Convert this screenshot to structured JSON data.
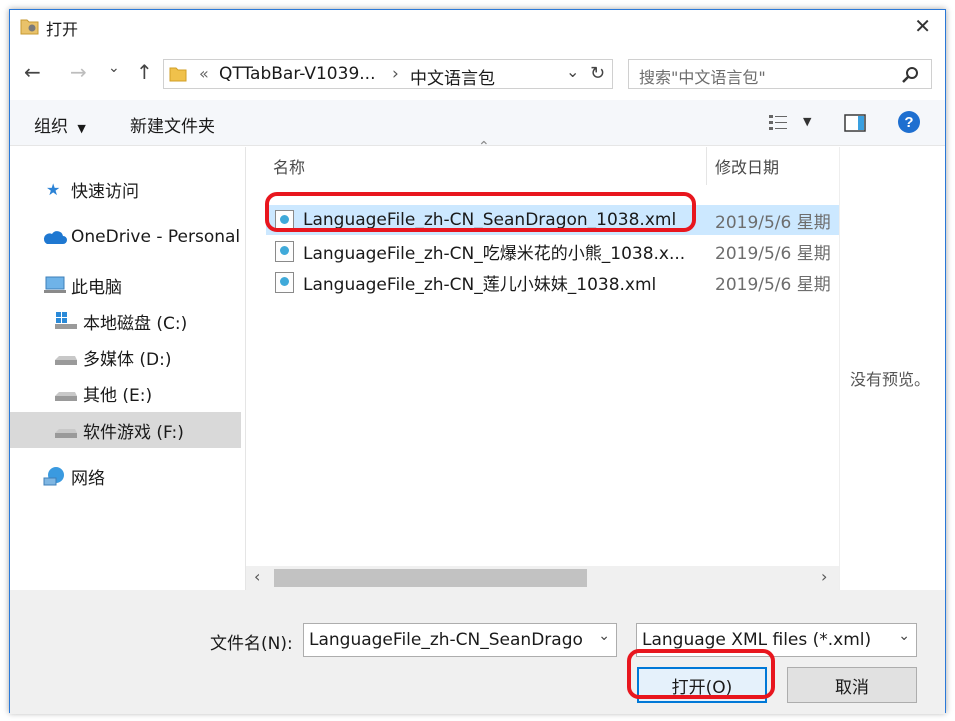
{
  "window": {
    "title": "打开"
  },
  "nav": {
    "back": "←",
    "forward": "→",
    "recent": "⌄",
    "up": "↑",
    "refresh": "↻"
  },
  "address": {
    "overflow": "«",
    "segments": [
      "QTTabBar-V1039...",
      "中文语言包"
    ],
    "separator": "›"
  },
  "search": {
    "placeholder": "搜索\"中文语言包\""
  },
  "toolbar": {
    "organize": "组织",
    "new_folder": "新建文件夹"
  },
  "sidebar": {
    "items": [
      {
        "label": "快速访问"
      },
      {
        "label": "OneDrive - Personal"
      },
      {
        "label": "此电脑"
      },
      {
        "label": "本地磁盘 (C:)"
      },
      {
        "label": "多媒体 (D:)"
      },
      {
        "label": "其他 (E:)"
      },
      {
        "label": "软件游戏 (F:)"
      },
      {
        "label": "网络"
      }
    ]
  },
  "columns": {
    "name": "名称",
    "modified": "修改日期"
  },
  "files": [
    {
      "name": "LanguageFile_zh-CN_SeanDragon_1038.xml",
      "date": "2019/5/6 星期"
    },
    {
      "name": "LanguageFile_zh-CN_吃爆米花的小熊_1038.x...",
      "date": "2019/5/6 星期"
    },
    {
      "name": "LanguageFile_zh-CN_莲儿小妹妹_1038.xml",
      "date": "2019/5/6 星期"
    }
  ],
  "preview": {
    "text": "没有预览。"
  },
  "bottom": {
    "filename_label": "文件名(N):",
    "filename_value": "LanguageFile_zh-CN_SeanDrago",
    "filetype": "Language XML files (*.xml)",
    "open": "打开(O)",
    "cancel": "取消"
  },
  "colors": {
    "accent": "#2b79d8",
    "highlight": "#e8161e",
    "selected_row": "#cce8ff"
  }
}
